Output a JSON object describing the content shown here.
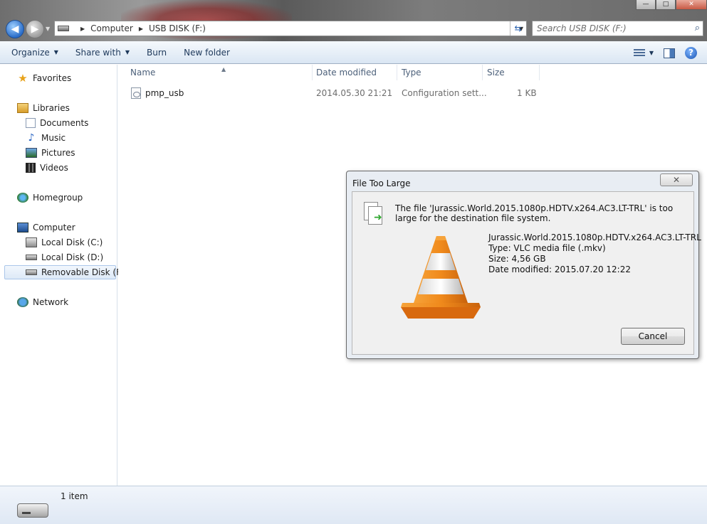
{
  "window": {
    "controls": {
      "minimize": "—",
      "maximize": "□",
      "close": "✕"
    }
  },
  "address": {
    "crumbs": [
      "Computer",
      "USB DISK (F:)"
    ],
    "search_placeholder": "Search USB DISK (F:)"
  },
  "toolbar": {
    "organize": "Organize",
    "share_with": "Share with",
    "burn": "Burn",
    "new_folder": "New folder"
  },
  "nav": {
    "favorites": "Favorites",
    "libraries": "Libraries",
    "documents": "Documents",
    "music": "Music",
    "pictures": "Pictures",
    "videos": "Videos",
    "homegroup": "Homegroup",
    "computer": "Computer",
    "local_c": "Local Disk (C:)",
    "local_d": "Local Disk (D:)",
    "removable_f": "Removable Disk (F:)",
    "network": "Network"
  },
  "columns": {
    "name": "Name",
    "date_modified": "Date modified",
    "type": "Type",
    "size": "Size"
  },
  "files": [
    {
      "name": "pmp_usb",
      "date_modified": "2014.05.30 21:21",
      "type": "Configuration sett...",
      "size": "1 KB"
    }
  ],
  "status": {
    "items": "1 item"
  },
  "dialog": {
    "title": "File Too Large",
    "close": "✕",
    "message": "The file 'Jurassic.World.2015.1080p.HDTV.x264.AC3.LT-TRL' is too large for the destination file system.",
    "file_name": "Jurassic.World.2015.1080p.HDTV.x264.AC3.LT-TRL",
    "file_type": "Type: VLC media file (.mkv)",
    "file_size": "Size: 4,56 GB",
    "file_date": "Date modified: 2015.07.20 12:22",
    "cancel": "Cancel"
  },
  "colors": {
    "accent": "#1e395b",
    "cone_orange": "#f08a1c",
    "selection": "#dde9f7"
  }
}
